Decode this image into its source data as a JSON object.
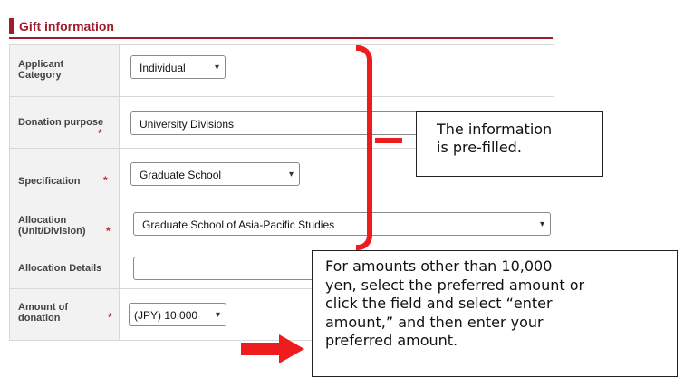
{
  "section": {
    "title": "Gift information"
  },
  "form": {
    "applicant_category": {
      "label": "Applicant\nCategory",
      "value": "Individual"
    },
    "donation_purpose": {
      "label": "Donation purpose",
      "required": "*",
      "value": "University Divisions"
    },
    "specification": {
      "label": "Specification",
      "required": "*",
      "value": "Graduate School"
    },
    "allocation": {
      "label": "Allocation\n(Unit/Division)",
      "required": "*",
      "value": "Graduate School of Asia-Pacific Studies"
    },
    "allocation_details": {
      "label": "Allocation Details",
      "value": ""
    },
    "amount": {
      "label": "Amount of\ndonation",
      "required": "*",
      "value": "(JPY) 10,000"
    }
  },
  "callouts": {
    "prefilled": "The information\nis pre-filled.",
    "amount_note": "For amounts other than 10,000\nyen, select the preferred amount or\nclick the field and select “enter\namount,” and then enter your\npreferred amount."
  },
  "colors": {
    "accent": "#a01c2b",
    "annotation_red": "#ee1c1c",
    "label_bg": "#f2f2f2"
  },
  "icons": {
    "select_chevron": "chevron-down-icon"
  }
}
